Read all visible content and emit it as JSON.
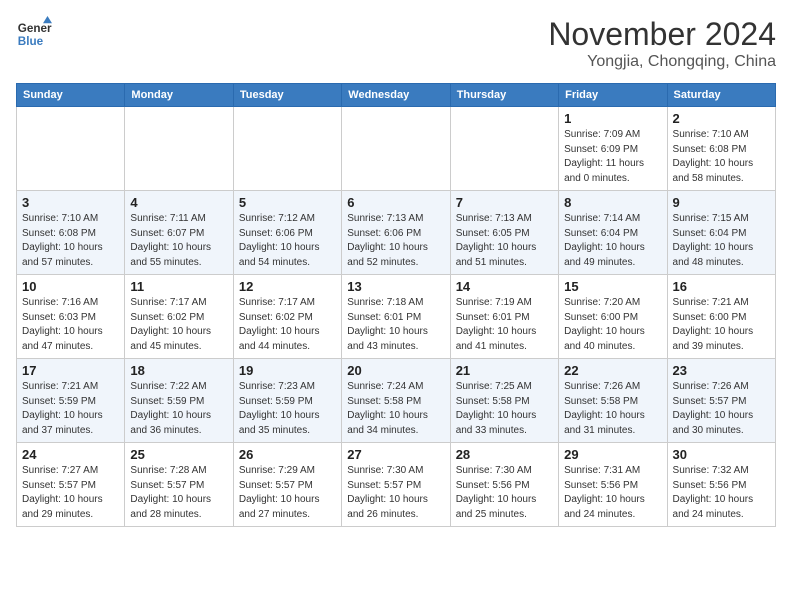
{
  "header": {
    "logo_line1": "General",
    "logo_line2": "Blue",
    "month": "November 2024",
    "location": "Yongjia, Chongqing, China"
  },
  "weekdays": [
    "Sunday",
    "Monday",
    "Tuesday",
    "Wednesday",
    "Thursday",
    "Friday",
    "Saturday"
  ],
  "weeks": [
    [
      {
        "day": "",
        "info": ""
      },
      {
        "day": "",
        "info": ""
      },
      {
        "day": "",
        "info": ""
      },
      {
        "day": "",
        "info": ""
      },
      {
        "day": "",
        "info": ""
      },
      {
        "day": "1",
        "info": "Sunrise: 7:09 AM\nSunset: 6:09 PM\nDaylight: 11 hours\nand 0 minutes."
      },
      {
        "day": "2",
        "info": "Sunrise: 7:10 AM\nSunset: 6:08 PM\nDaylight: 10 hours\nand 58 minutes."
      }
    ],
    [
      {
        "day": "3",
        "info": "Sunrise: 7:10 AM\nSunset: 6:08 PM\nDaylight: 10 hours\nand 57 minutes."
      },
      {
        "day": "4",
        "info": "Sunrise: 7:11 AM\nSunset: 6:07 PM\nDaylight: 10 hours\nand 55 minutes."
      },
      {
        "day": "5",
        "info": "Sunrise: 7:12 AM\nSunset: 6:06 PM\nDaylight: 10 hours\nand 54 minutes."
      },
      {
        "day": "6",
        "info": "Sunrise: 7:13 AM\nSunset: 6:06 PM\nDaylight: 10 hours\nand 52 minutes."
      },
      {
        "day": "7",
        "info": "Sunrise: 7:13 AM\nSunset: 6:05 PM\nDaylight: 10 hours\nand 51 minutes."
      },
      {
        "day": "8",
        "info": "Sunrise: 7:14 AM\nSunset: 6:04 PM\nDaylight: 10 hours\nand 49 minutes."
      },
      {
        "day": "9",
        "info": "Sunrise: 7:15 AM\nSunset: 6:04 PM\nDaylight: 10 hours\nand 48 minutes."
      }
    ],
    [
      {
        "day": "10",
        "info": "Sunrise: 7:16 AM\nSunset: 6:03 PM\nDaylight: 10 hours\nand 47 minutes."
      },
      {
        "day": "11",
        "info": "Sunrise: 7:17 AM\nSunset: 6:02 PM\nDaylight: 10 hours\nand 45 minutes."
      },
      {
        "day": "12",
        "info": "Sunrise: 7:17 AM\nSunset: 6:02 PM\nDaylight: 10 hours\nand 44 minutes."
      },
      {
        "day": "13",
        "info": "Sunrise: 7:18 AM\nSunset: 6:01 PM\nDaylight: 10 hours\nand 43 minutes."
      },
      {
        "day": "14",
        "info": "Sunrise: 7:19 AM\nSunset: 6:01 PM\nDaylight: 10 hours\nand 41 minutes."
      },
      {
        "day": "15",
        "info": "Sunrise: 7:20 AM\nSunset: 6:00 PM\nDaylight: 10 hours\nand 40 minutes."
      },
      {
        "day": "16",
        "info": "Sunrise: 7:21 AM\nSunset: 6:00 PM\nDaylight: 10 hours\nand 39 minutes."
      }
    ],
    [
      {
        "day": "17",
        "info": "Sunrise: 7:21 AM\nSunset: 5:59 PM\nDaylight: 10 hours\nand 37 minutes."
      },
      {
        "day": "18",
        "info": "Sunrise: 7:22 AM\nSunset: 5:59 PM\nDaylight: 10 hours\nand 36 minutes."
      },
      {
        "day": "19",
        "info": "Sunrise: 7:23 AM\nSunset: 5:59 PM\nDaylight: 10 hours\nand 35 minutes."
      },
      {
        "day": "20",
        "info": "Sunrise: 7:24 AM\nSunset: 5:58 PM\nDaylight: 10 hours\nand 34 minutes."
      },
      {
        "day": "21",
        "info": "Sunrise: 7:25 AM\nSunset: 5:58 PM\nDaylight: 10 hours\nand 33 minutes."
      },
      {
        "day": "22",
        "info": "Sunrise: 7:26 AM\nSunset: 5:58 PM\nDaylight: 10 hours\nand 31 minutes."
      },
      {
        "day": "23",
        "info": "Sunrise: 7:26 AM\nSunset: 5:57 PM\nDaylight: 10 hours\nand 30 minutes."
      }
    ],
    [
      {
        "day": "24",
        "info": "Sunrise: 7:27 AM\nSunset: 5:57 PM\nDaylight: 10 hours\nand 29 minutes."
      },
      {
        "day": "25",
        "info": "Sunrise: 7:28 AM\nSunset: 5:57 PM\nDaylight: 10 hours\nand 28 minutes."
      },
      {
        "day": "26",
        "info": "Sunrise: 7:29 AM\nSunset: 5:57 PM\nDaylight: 10 hours\nand 27 minutes."
      },
      {
        "day": "27",
        "info": "Sunrise: 7:30 AM\nSunset: 5:57 PM\nDaylight: 10 hours\nand 26 minutes."
      },
      {
        "day": "28",
        "info": "Sunrise: 7:30 AM\nSunset: 5:56 PM\nDaylight: 10 hours\nand 25 minutes."
      },
      {
        "day": "29",
        "info": "Sunrise: 7:31 AM\nSunset: 5:56 PM\nDaylight: 10 hours\nand 24 minutes."
      },
      {
        "day": "30",
        "info": "Sunrise: 7:32 AM\nSunset: 5:56 PM\nDaylight: 10 hours\nand 24 minutes."
      }
    ]
  ]
}
